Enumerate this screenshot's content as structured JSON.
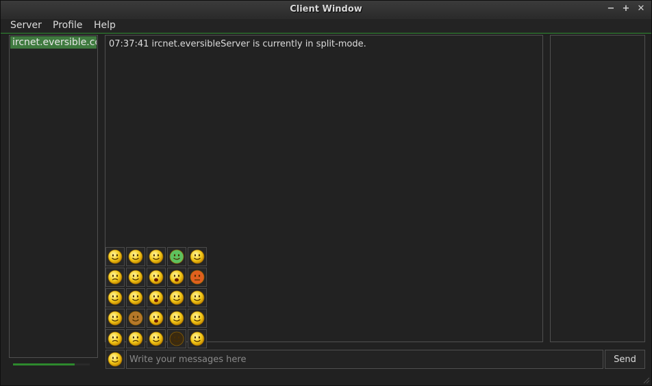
{
  "window": {
    "title": "Client Window",
    "minimize": "−",
    "maximize": "+",
    "close": "✕"
  },
  "menu": {
    "items": [
      "Server",
      "Profile",
      "Help"
    ]
  },
  "servers": {
    "items": [
      "ircnet.eversible.com"
    ]
  },
  "chat": {
    "messages": [
      "07:37:41 ircnet.eversibleServer is currently in split-mode."
    ]
  },
  "progress": {
    "fraction": 0.8
  },
  "input": {
    "placeholder": "Write your messages here",
    "value": ""
  },
  "send": {
    "label": "Send"
  },
  "emojis": [
    [
      "smile",
      "grin",
      "glasses",
      "sick",
      "blush"
    ],
    [
      "sad",
      "confused",
      "cry",
      "scared",
      "angry"
    ],
    [
      "teeth",
      "tongue",
      "shout",
      "dizzy",
      "wink"
    ],
    [
      "kiss",
      "monkey",
      "surprised",
      "love",
      "shy"
    ],
    [
      "tears",
      "worried",
      "crazy",
      "devil",
      "angel"
    ]
  ],
  "colors": {
    "accent": "#2f8d31",
    "selection": "#3f7a3f"
  }
}
